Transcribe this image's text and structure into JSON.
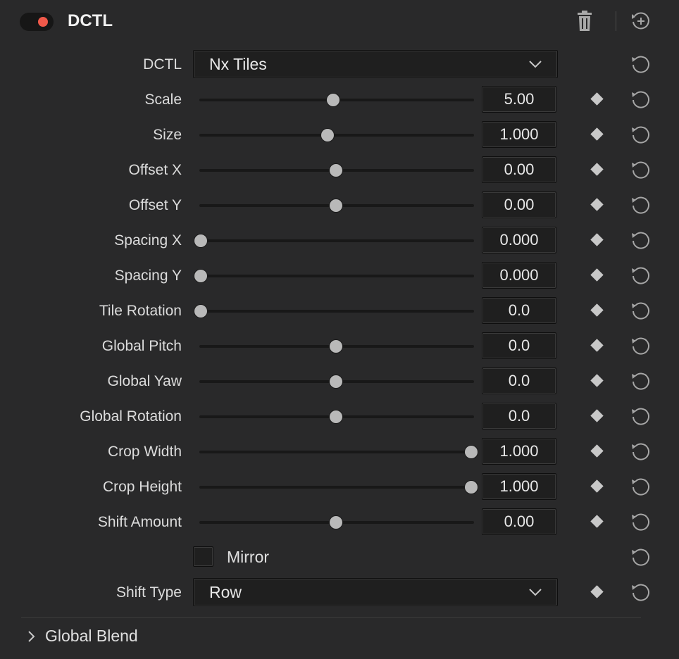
{
  "header": {
    "title": "DCTL",
    "enabled": true,
    "toggle_color": "#f0594a",
    "delete_icon": "trash-icon",
    "reset_all_icon": "reset-add-icon"
  },
  "dctl_select": {
    "label": "DCTL",
    "value": "Nx Tiles"
  },
  "sliders": [
    {
      "label": "Scale",
      "value": "5.00",
      "level": 0.49
    },
    {
      "label": "Size",
      "value": "1.000",
      "level": 0.47
    },
    {
      "label": "Offset X",
      "value": "0.00",
      "level": 0.5
    },
    {
      "label": "Offset Y",
      "value": "0.00",
      "level": 0.5
    },
    {
      "label": "Spacing X",
      "value": "0.000",
      "level": 0.0
    },
    {
      "label": "Spacing Y",
      "value": "0.000",
      "level": 0.0
    },
    {
      "label": "Tile Rotation",
      "value": "0.0",
      "level": 0.0
    },
    {
      "label": "Global Pitch",
      "value": "0.0",
      "level": 0.5
    },
    {
      "label": "Global Yaw",
      "value": "0.0",
      "level": 0.5
    },
    {
      "label": "Global Rotation",
      "value": "0.0",
      "level": 0.5
    },
    {
      "label": "Crop Width",
      "value": "1.000",
      "level": 1.0
    },
    {
      "label": "Crop Height",
      "value": "1.000",
      "level": 1.0
    },
    {
      "label": "Shift Amount",
      "value": "0.00",
      "level": 0.5
    }
  ],
  "mirror": {
    "label": "Mirror",
    "checked": false
  },
  "shift_type": {
    "label": "Shift Type",
    "value": "Row"
  },
  "global_blend": {
    "label": "Global Blend",
    "expanded": false
  }
}
